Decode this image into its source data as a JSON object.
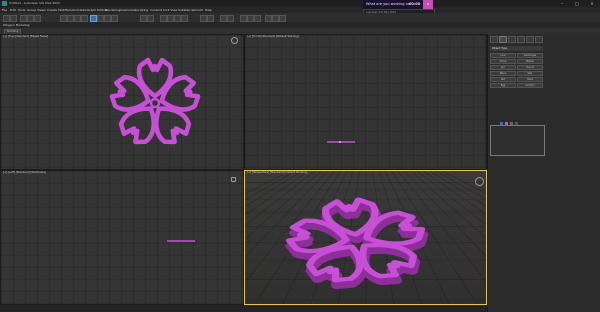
{
  "window": {
    "title": "Untitled - Autodesk 3ds Max 2022",
    "icon": "app-icon",
    "controls": [
      "minimize-icon",
      "maximize-icon",
      "close-icon"
    ]
  },
  "menu": [
    "File",
    "Edit",
    "Tools",
    "Group",
    "Views",
    "Create",
    "Modifiers",
    "Animation",
    "Graph Editors",
    "Rendering",
    "Customize",
    "Scripting",
    "Content",
    "Civil View",
    "Substance",
    "Arnold",
    "Help"
  ],
  "popup": {
    "question": "What are you working on",
    "timer": "00:00"
  },
  "search": {
    "placeholder": "Autodesk 3ds Max 2022"
  },
  "ribbon": {
    "label": "Polygon Modeling"
  },
  "ribbon_tabs": [
    "Modeling",
    "Freeform",
    "Selection",
    "Object Paint",
    "Populate"
  ],
  "viewports": {
    "top": "[+] [Top] [Standard] [Edged Faces]",
    "front": "[+] [Front] [Standard] [Default Shading]",
    "left": "[+] [Left] [Standard] [Wireframe]",
    "perspective": "[+] [Perspective] [Standard] [Default Shading]"
  },
  "command_panel": {
    "tabs": [
      "create-icon",
      "modify-icon",
      "hierarchy-icon",
      "motion-icon",
      "display-icon",
      "utilities-icon"
    ],
    "section": "Object Type",
    "buttons": [
      "Line",
      "Rectangle",
      "Circle",
      "Ellipse",
      "Arc",
      "Donut",
      "NGon",
      "Star",
      "Text",
      "Helix",
      "Egg",
      "Section"
    ],
    "name_color_section": "Name and Color",
    "swatch_color": "#c44fd8"
  },
  "colors": {
    "sakura": "#c64fd6",
    "sakura_dark": "#8d2f98",
    "popup_accent": "#c44fb6",
    "active_viewport": "#e6c84a"
  }
}
